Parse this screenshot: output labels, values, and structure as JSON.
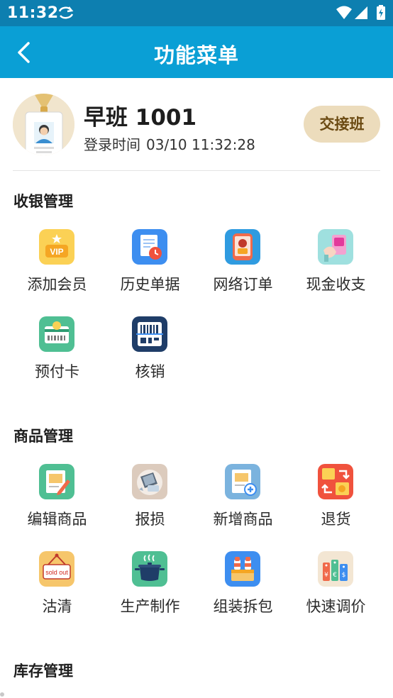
{
  "status_bar": {
    "time": "11:32",
    "icons": [
      "sync-icon",
      "wifi-icon",
      "signal-icon",
      "battery-charging-icon"
    ]
  },
  "header": {
    "title": "功能菜单",
    "back_icon": "back-arrow-icon",
    "color": "#0a9fd5"
  },
  "profile": {
    "shift_name": "早班 1001",
    "login_label": "登录时间",
    "login_time": "03/10 11:32:28",
    "handover_label": "交接班",
    "handover_color": "#ecdcbc"
  },
  "sections": [
    {
      "title": "收银管理",
      "items": [
        {
          "label": "添加会员",
          "icon": "vip-card-icon"
        },
        {
          "label": "历史单据",
          "icon": "history-receipt-icon"
        },
        {
          "label": "网络订单",
          "icon": "online-order-icon"
        },
        {
          "label": "现金收支",
          "icon": "cash-payment-icon"
        },
        {
          "label": "预付卡",
          "icon": "prepaid-card-icon"
        },
        {
          "label": "核销",
          "icon": "barcode-verify-icon"
        }
      ]
    },
    {
      "title": "商品管理",
      "items": [
        {
          "label": "编辑商品",
          "icon": "edit-product-icon"
        },
        {
          "label": "报损",
          "icon": "damage-report-icon"
        },
        {
          "label": "新增商品",
          "icon": "add-product-icon"
        },
        {
          "label": "退货",
          "icon": "return-goods-icon"
        },
        {
          "label": "沽清",
          "icon": "sold-out-icon",
          "badge_text": "sold out"
        },
        {
          "label": "生产制作",
          "icon": "cooking-pot-icon"
        },
        {
          "label": "组装拆包",
          "icon": "assemble-package-icon"
        },
        {
          "label": "快速调价",
          "icon": "price-tag-icon"
        }
      ]
    },
    {
      "title": "库存管理",
      "items": []
    }
  ]
}
